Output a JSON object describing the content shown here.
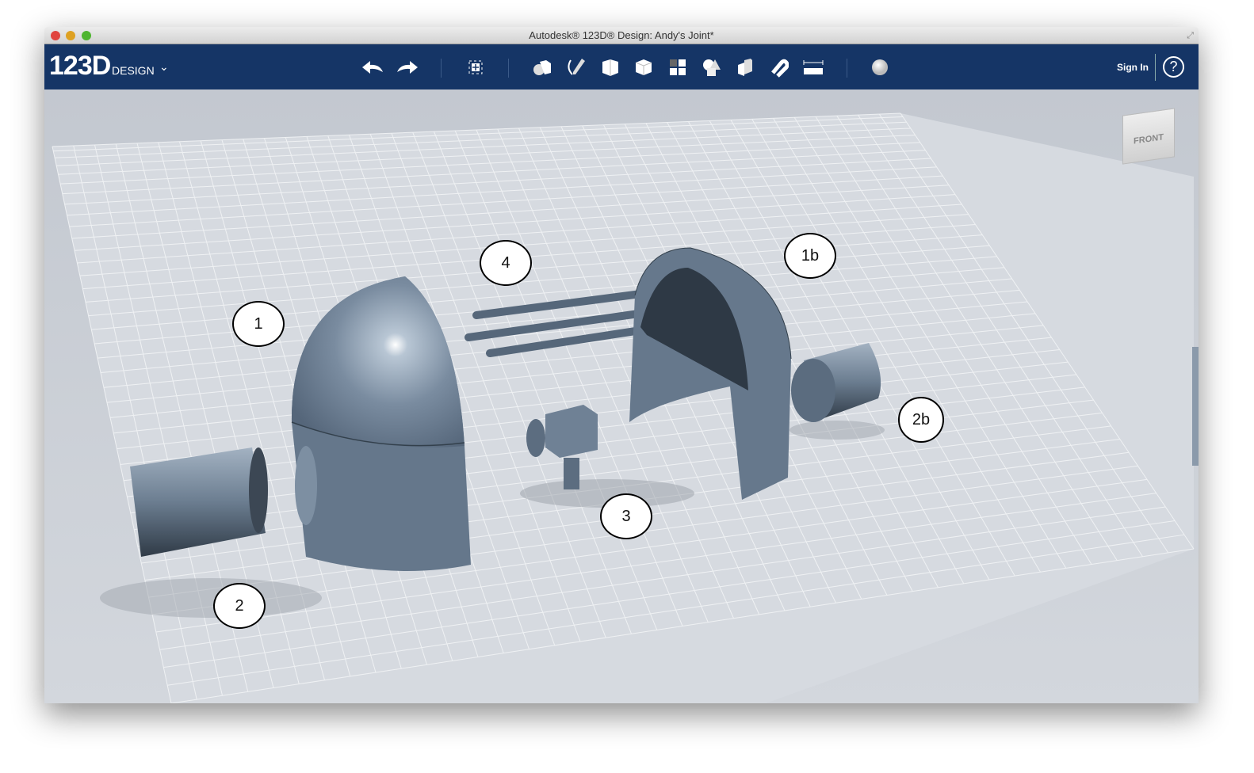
{
  "window": {
    "title": "Autodesk® 123D® Design: Andy's Joint*",
    "traffic_lights": [
      "#e0443e",
      "#dea123",
      "#4fb530"
    ]
  },
  "toolbar": {
    "logo": "123D",
    "logo_sub": "DESIGN",
    "tools": [
      "undo-icon",
      "redo-icon",
      "transform-icon",
      "primitives-icon",
      "sketch-icon",
      "construct-icon",
      "modify-icon",
      "pattern-icon",
      "grouping-icon",
      "combine-icon",
      "snap-icon",
      "measure-icon",
      "material-icon"
    ],
    "sign_in": "Sign In",
    "help": "?"
  },
  "viewcube": {
    "face": "FRONT"
  },
  "callouts": [
    "1",
    "2",
    "3",
    "4",
    "1b",
    "2b"
  ],
  "colors": {
    "toolbar": "#153566",
    "part": "#6d7f92",
    "grid_bg": "#c9cdd4"
  }
}
